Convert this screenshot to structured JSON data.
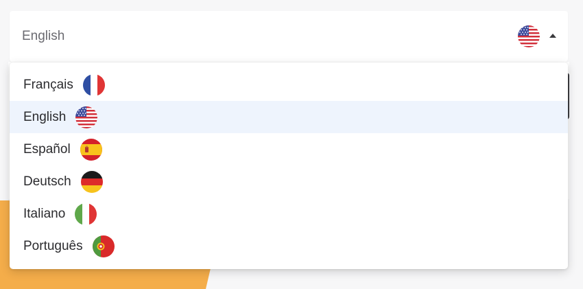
{
  "select": {
    "current_value": "English",
    "current_flag": "us-flag-icon",
    "caret_icon": "caret-up-icon"
  },
  "dropdown": {
    "options": [
      {
        "label": "Français",
        "flag": "france-flag-icon",
        "selected": false
      },
      {
        "label": "English",
        "flag": "us-flag-icon",
        "selected": true
      },
      {
        "label": "Español",
        "flag": "spain-flag-icon",
        "selected": false
      },
      {
        "label": "Deutsch",
        "flag": "germany-flag-icon",
        "selected": false
      },
      {
        "label": "Italiano",
        "flag": "italy-flag-icon",
        "selected": false
      },
      {
        "label": "Português",
        "flag": "portugal-flag-icon",
        "selected": false
      }
    ]
  },
  "colors": {
    "selected_row": "#eef4fd",
    "background_accent": "#f4ad4a",
    "text": "#2b2b2e",
    "placeholder_text": "#6a6a70"
  }
}
